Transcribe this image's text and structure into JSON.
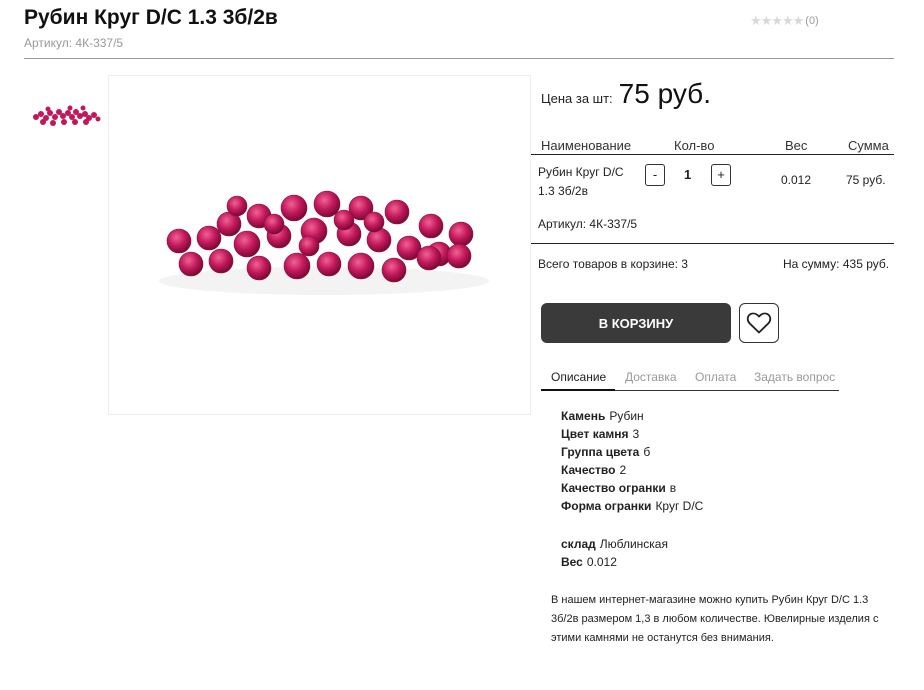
{
  "product": {
    "title": "Рубин Круг D/С 1.3 3б/2в",
    "sku_label": "Артикул: 4К-337/5",
    "rating_count": "(0)",
    "rating_value": 0,
    "price_label": "Цена за шт:",
    "price_value": "75 руб."
  },
  "table": {
    "headers": {
      "name": "Наименование",
      "qty": "Кол-во",
      "weight": "Вес",
      "sum": "Сумма"
    },
    "row": {
      "name_line1": "Рубин Круг D/С",
      "name_line2": "1.3 3б/2в",
      "minus": "-",
      "qty": "1",
      "plus": "+",
      "weight": "0.012",
      "sum": "75 руб."
    },
    "sku": "Артикул: 4К-337/5",
    "total_items": "Всего товаров в корзине: 3",
    "total_sum": "На сумму: 435 руб."
  },
  "actions": {
    "cart_button": "В КОРЗИНУ",
    "favorite_icon": "heart-icon"
  },
  "tabs": [
    {
      "label": "Описание",
      "active": true
    },
    {
      "label": "Доставка",
      "active": false
    },
    {
      "label": "Оплата",
      "active": false
    },
    {
      "label": "Задать вопрос",
      "active": false
    }
  ],
  "specs": [
    {
      "label": "Камень",
      "value": "Рубин"
    },
    {
      "label": "Цвет камня",
      "value": "3"
    },
    {
      "label": "Группа цвета",
      "value": "б"
    },
    {
      "label": "Качество",
      "value": "2"
    },
    {
      "label": "Качество огранки",
      "value": "в"
    },
    {
      "label": "Форма огранки",
      "value": "Круг D/C"
    },
    {
      "label": "склад",
      "value": "Люблинская"
    },
    {
      "label": "Вес",
      "value": "0.012"
    }
  ],
  "description": "В нашем интернет-магазине можно купить Рубин Круг D/С 1.3 3б/2в размером 1,3 в любом количестве. Ювелирные изделия с этими камнями не останутся без внимания.",
  "colors": {
    "ruby": "#c2185b",
    "button_dark": "#3a3a3a"
  }
}
